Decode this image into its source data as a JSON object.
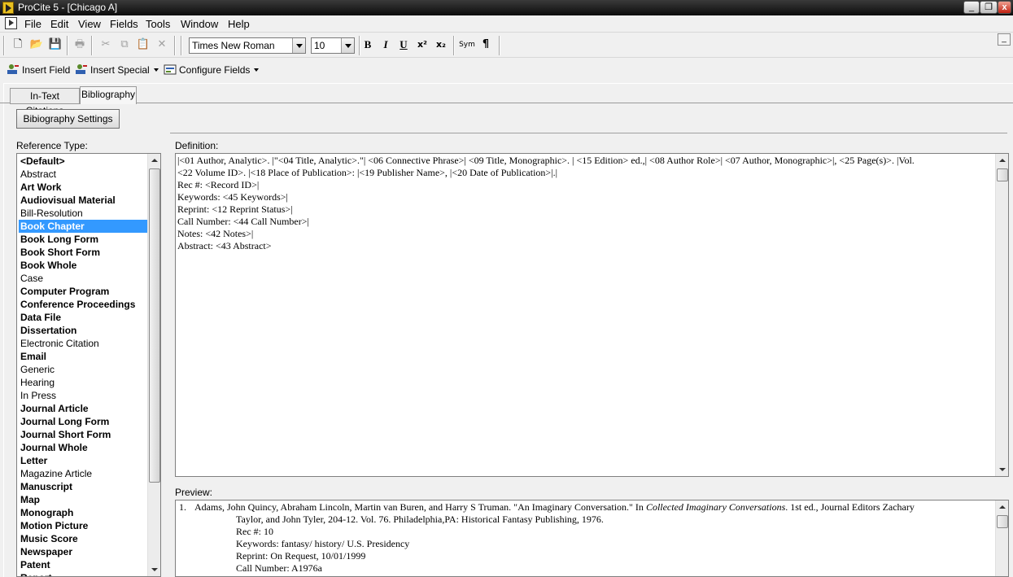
{
  "window": {
    "title": "ProCite 5 - [Chicago A]",
    "minimize_glyph": "_",
    "restore_glyph": "❐",
    "close_glyph": "x",
    "mdi_glyph": "_"
  },
  "menu": [
    "File",
    "Edit",
    "View",
    "Fields",
    "Tools",
    "Window",
    "Help"
  ],
  "toolbar": {
    "font_name": "Times New Roman",
    "font_size": "10",
    "bold": "B",
    "italic": "I",
    "underline": "U",
    "superscript": "x²",
    "subscript": "x₂",
    "sym": "Sym",
    "paragraph": "¶"
  },
  "fields_toolbar": {
    "insert_field": "Insert Field",
    "insert_special": "Insert Special",
    "configure_fields": "Configure Fields"
  },
  "tabs": [
    "In-Text Citations",
    "Bibliography"
  ],
  "active_tab": "Bibliography",
  "bibliography_settings": "Bibiography Settings",
  "labels": {
    "reference_type": "Reference Type:",
    "definition": "Definition:",
    "preview": "Preview:"
  },
  "reference_types": [
    {
      "label": "<Default>",
      "bold": true
    },
    {
      "label": "Abstract",
      "bold": false
    },
    {
      "label": "Art Work",
      "bold": true
    },
    {
      "label": "Audiovisual Material",
      "bold": true
    },
    {
      "label": "Bill-Resolution",
      "bold": false
    },
    {
      "label": "Book Chapter",
      "bold": true,
      "selected": true
    },
    {
      "label": "Book Long Form",
      "bold": true
    },
    {
      "label": "Book Short Form",
      "bold": true
    },
    {
      "label": "Book Whole",
      "bold": true
    },
    {
      "label": "Case",
      "bold": false
    },
    {
      "label": "Computer Program",
      "bold": true
    },
    {
      "label": "Conference Proceedings",
      "bold": true
    },
    {
      "label": "Data File",
      "bold": true
    },
    {
      "label": "Dissertation",
      "bold": true
    },
    {
      "label": "Electronic Citation",
      "bold": false
    },
    {
      "label": "Email",
      "bold": true
    },
    {
      "label": "Generic",
      "bold": false
    },
    {
      "label": "Hearing",
      "bold": false
    },
    {
      "label": "In Press",
      "bold": false
    },
    {
      "label": "Journal Article",
      "bold": true
    },
    {
      "label": "Journal Long Form",
      "bold": true
    },
    {
      "label": "Journal Short Form",
      "bold": true
    },
    {
      "label": "Journal Whole",
      "bold": true
    },
    {
      "label": "Letter",
      "bold": true
    },
    {
      "label": "Magazine Article",
      "bold": false
    },
    {
      "label": "Manuscript",
      "bold": true
    },
    {
      "label": "Map",
      "bold": true
    },
    {
      "label": "Monograph",
      "bold": true
    },
    {
      "label": "Motion Picture",
      "bold": true
    },
    {
      "label": "Music Score",
      "bold": true
    },
    {
      "label": "Newspaper",
      "bold": true
    },
    {
      "label": "Patent",
      "bold": true
    },
    {
      "label": "Report",
      "bold": true
    }
  ],
  "definition_lines": [
    "|<01 Author, Analytic>. |\"<04 Title, Analytic>.\"| <06 Connective Phrase>| <09 Title, Monographic>. | <15 Edition> ed.,| <08 Author Role>| <07 Author, Monographic>|, <25 Page(s)>. |Vol.",
    "<22 Volume ID>. |<18 Place of Publication>: |<19 Publisher Name>, |<20 Date of Publication>|.|",
    "Rec #: <Record ID>|",
    "Keywords: <45 Keywords>|",
    "Reprint: <12 Reprint Status>|",
    "Call Number: <44 Call Number>|",
    "Notes: <42 Notes>|",
    "Abstract: <43 Abstract>"
  ],
  "preview": {
    "number": "1.",
    "line1_pre": "Adams, John Quincy, Abraham Lincoln, Martin van Buren, and Harry S Truman. \"An Imaginary Conversation.\" In ",
    "line1_italic": "Collected Imaginary Conversations",
    "line1_post": ". 1st ed., Journal Editors Zachary",
    "line2": "Taylor, and John Tyler, 204-12. Vol. 76. Philadelphia,PA: Historical Fantasy Publishing, 1976.",
    "lines": [
      "Rec #: 10",
      "Keywords: fantasy/ history/ U.S. Presidency",
      "Reprint: On Request, 10/01/1999",
      "Call Number: A1976a"
    ]
  }
}
